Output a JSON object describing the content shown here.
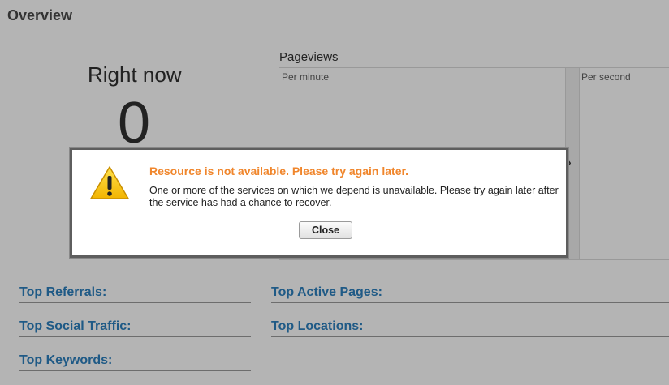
{
  "page": {
    "title": "Overview"
  },
  "right_now": {
    "label": "Right now",
    "value": "0"
  },
  "pageviews": {
    "title": "Pageviews",
    "per_minute_label": "Per minute",
    "per_second_label": "Per second",
    "chevron": "›"
  },
  "sections": {
    "top_referrals": "Top Referrals:",
    "top_social_traffic": "Top Social Traffic:",
    "top_keywords": "Top Keywords:",
    "top_active_pages": "Top Active Pages:",
    "top_locations": "Top Locations:"
  },
  "modal": {
    "title": "Resource is not available. Please try again later.",
    "message": "One or more of the services on which we depend is unavailable. Please try again later after the service has had a chance to recover.",
    "close_label": "Close",
    "icon": "warning-icon"
  },
  "colors": {
    "background": "#b4b4b4",
    "section_link": "#1f5a86",
    "modal_title": "#f0862c",
    "warning_yellow": "#f6c500"
  }
}
